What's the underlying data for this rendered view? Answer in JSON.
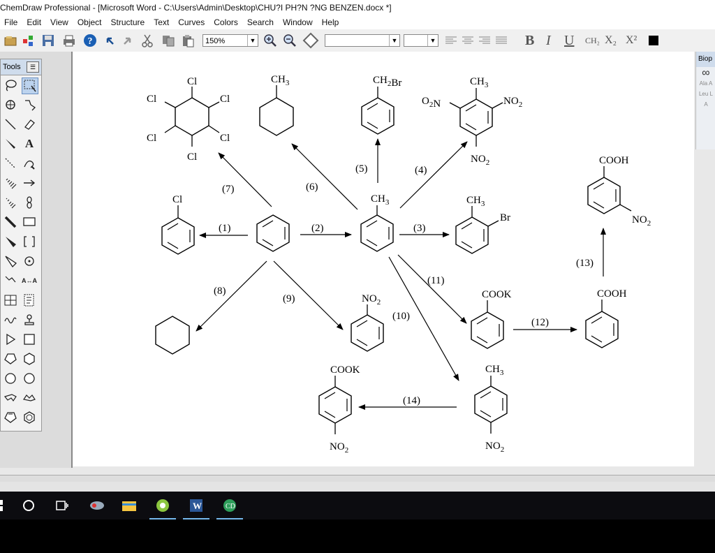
{
  "window": {
    "title": "ChemDraw Professional - [Microsoft Word - C:\\Users\\Admin\\Desktop\\CHU?I PH?N ?NG BENZEN.docx *]"
  },
  "menu": [
    "File",
    "Edit",
    "View",
    "Object",
    "Structure",
    "Text",
    "Curves",
    "Colors",
    "Search",
    "Window",
    "Help"
  ],
  "toolbar": {
    "zoom": "150%",
    "font_name": "",
    "font_size": "",
    "format_labels": {
      "bold": "B",
      "italic": "I",
      "underline": "U",
      "chem": "CH₂",
      "subscript": "X₂",
      "superscript": "X²"
    }
  },
  "tools_palette": {
    "title": "Tools",
    "items": [
      {
        "name": "lasso",
        "icon": "lasso-icon"
      },
      {
        "name": "marquee",
        "icon": "marquee-icon"
      },
      {
        "name": "structure-perspective",
        "icon": "rotate-icon"
      },
      {
        "name": "mass-fragment",
        "icon": "fragment-icon"
      },
      {
        "name": "solid-bond",
        "icon": "bond-icon"
      },
      {
        "name": "eraser",
        "icon": "eraser-icon"
      },
      {
        "name": "wedge-bond",
        "icon": "wedge-bond-icon"
      },
      {
        "name": "text",
        "icon": "text-icon",
        "label": "A"
      },
      {
        "name": "dashed-bond",
        "icon": "dashed-bond-icon"
      },
      {
        "name": "pen",
        "icon": "pen-icon"
      },
      {
        "name": "hashed-bond",
        "icon": "hashed-bond-icon"
      },
      {
        "name": "arrow",
        "icon": "arrow-icon"
      },
      {
        "name": "hashed-wedge",
        "icon": "hashed-wedge-icon"
      },
      {
        "name": "orbital",
        "icon": "orbital-icon"
      },
      {
        "name": "bold-bond",
        "icon": "bold-bond-icon"
      },
      {
        "name": "drawing-element",
        "icon": "rectangle-icon"
      },
      {
        "name": "bold-wedge",
        "icon": "bold-wedge-icon"
      },
      {
        "name": "bracket",
        "icon": "bracket-icon"
      },
      {
        "name": "hollow-wedge",
        "icon": "hollow-wedge-icon"
      },
      {
        "name": "symbol",
        "icon": "symbol-icon"
      },
      {
        "name": "chain",
        "icon": "chain-icon"
      },
      {
        "name": "atom-map",
        "icon": "atom-map-icon",
        "label": "A↔A"
      },
      {
        "name": "table",
        "icon": "table-icon"
      },
      {
        "name": "template",
        "icon": "template-icon"
      },
      {
        "name": "acyclic-chain",
        "icon": "acyclic-chain-icon"
      },
      {
        "name": "stamp",
        "icon": "stamp-icon"
      },
      {
        "name": "triangle",
        "icon": "cyclopropane-icon"
      },
      {
        "name": "square",
        "icon": "cyclobutane-icon"
      },
      {
        "name": "pentagon",
        "icon": "cyclopentane-icon"
      },
      {
        "name": "hexagon",
        "icon": "cyclohexane-icon"
      },
      {
        "name": "heptagon",
        "icon": "cycloheptane-icon"
      },
      {
        "name": "octagon",
        "icon": "cyclooctane-icon"
      },
      {
        "name": "chair-1",
        "icon": "chair1-icon"
      },
      {
        "name": "chair-2",
        "icon": "chair2-icon"
      },
      {
        "name": "cyclopentadiene",
        "icon": "cyclopentadiene-icon"
      },
      {
        "name": "benzene",
        "icon": "benzene-icon"
      }
    ]
  },
  "right_panel": {
    "title": "Biop",
    "items": [
      "Ala\nA",
      "Leu\nL",
      "A"
    ]
  },
  "reactions": {
    "labels": [
      "(1)",
      "(2)",
      "(3)",
      "(4)",
      "(5)",
      "(6)",
      "(7)",
      "(8)",
      "(9)",
      "(10)",
      "(11)",
      "(12)",
      "(13)",
      "(14)"
    ]
  },
  "molecules": {
    "chlorobenzene": {
      "subs": [
        "Cl"
      ]
    },
    "hexachlorocyclohexane": {
      "subs": [
        "Cl",
        "Cl",
        "Cl",
        "Cl",
        "Cl",
        "Cl"
      ]
    },
    "methylcyclohexane": {
      "subs": [
        "CH3"
      ]
    },
    "benzyl_bromide": {
      "subs": [
        "CH2Br"
      ]
    },
    "tnt": {
      "subs": [
        "CH3",
        "O2N",
        "NO2",
        "NO2"
      ]
    },
    "toluene": {
      "subs": [
        "CH3"
      ]
    },
    "o_bromotoluene": {
      "subs": [
        "CH3",
        "Br"
      ]
    },
    "m_nitrobenzoic_acid": {
      "subs": [
        "COOH",
        "NO2"
      ]
    },
    "nitrobenzene": {
      "subs": [
        "NO2"
      ]
    },
    "potassium_benzoate": {
      "subs": [
        "COOK"
      ]
    },
    "benzoic_acid": {
      "subs": [
        "COOH"
      ]
    },
    "p_nitrotoluene": {
      "subs": [
        "CH3",
        "NO2"
      ]
    },
    "p_nitrobenzoate": {
      "subs": [
        "COOK",
        "NO2"
      ]
    }
  },
  "taskbar": {
    "items": [
      "start",
      "search",
      "task-view",
      "app-1",
      "file-explorer",
      "app-green",
      "word",
      "chemdraw"
    ]
  }
}
